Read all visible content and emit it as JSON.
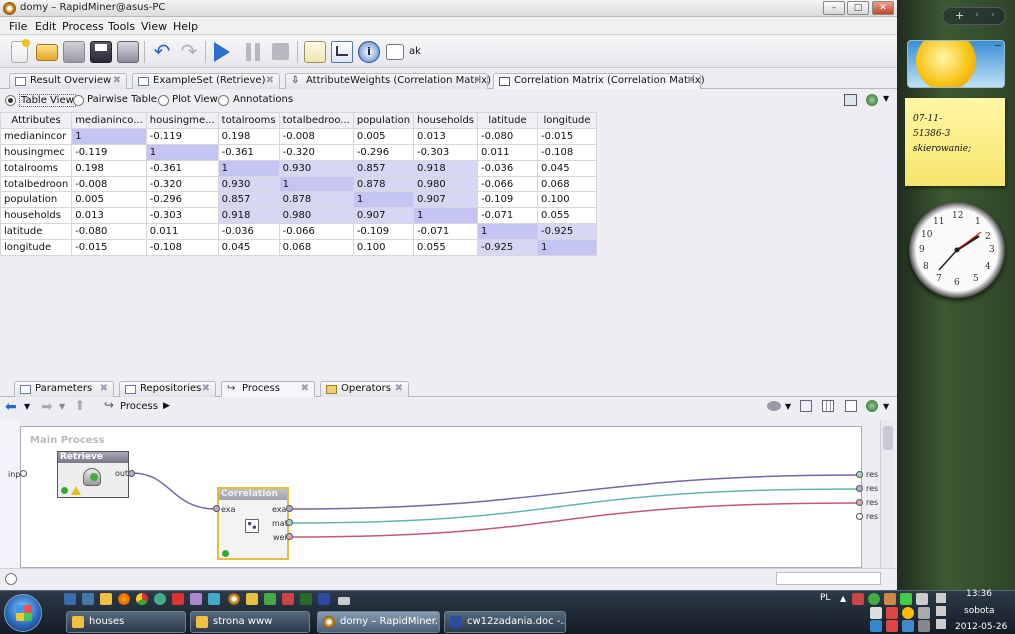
{
  "window": {
    "title": "domy – RapidMiner@asus-PC",
    "min": "–",
    "max": "□",
    "close": "✕"
  },
  "menu": [
    "File",
    "Edit",
    "Process",
    "Tools",
    "View",
    "Help"
  ],
  "toolbar": {
    "ak_label": "ak"
  },
  "result_tabs": [
    {
      "label": "Result Overview"
    },
    {
      "label": "ExampleSet (Retrieve)"
    },
    {
      "label": "AttributeWeights (Correlation Matrix)"
    },
    {
      "label": "Correlation Matrix (Correlation Matrix)"
    }
  ],
  "view_options": [
    "Table View",
    "Pairwise Table",
    "Plot View",
    "Annotations"
  ],
  "matrix": {
    "headers": [
      "Attributes",
      "medianinco...",
      "housingme...",
      "totalrooms",
      "totalbedroo...",
      "population",
      "households",
      "latitude",
      "longitude"
    ],
    "rows": [
      [
        "medianincor",
        "1",
        "-0.119",
        "0.198",
        "-0.008",
        "0.005",
        "0.013",
        "-0.080",
        "-0.015"
      ],
      [
        "housingmec",
        "-0.119",
        "1",
        "-0.361",
        "-0.320",
        "-0.296",
        "-0.303",
        "0.011",
        "-0.108"
      ],
      [
        "totalrooms",
        "0.198",
        "-0.361",
        "1",
        "0.930",
        "0.857",
        "0.918",
        "-0.036",
        "0.045"
      ],
      [
        "totalbedroon",
        "-0.008",
        "-0.320",
        "0.930",
        "1",
        "0.878",
        "0.980",
        "-0.066",
        "0.068"
      ],
      [
        "population",
        "0.005",
        "-0.296",
        "0.857",
        "0.878",
        "1",
        "0.907",
        "-0.109",
        "0.100"
      ],
      [
        "households",
        "0.013",
        "-0.303",
        "0.918",
        "0.980",
        "0.907",
        "1",
        "-0.071",
        "0.055"
      ],
      [
        "latitude",
        "-0.080",
        "0.011",
        "-0.036",
        "-0.066",
        "-0.109",
        "-0.071",
        "1",
        "-0.925"
      ],
      [
        "longitude",
        "-0.015",
        "-0.108",
        "0.045",
        "0.068",
        "0.100",
        "0.055",
        "-0.925",
        "1"
      ]
    ]
  },
  "lower_tabs": [
    {
      "label": "Parameters"
    },
    {
      "label": "Repositories"
    },
    {
      "label": "Process"
    },
    {
      "label": "Operators"
    }
  ],
  "process": {
    "breadcrumb": "Process",
    "main_label": "Main Process",
    "inp_label": "inp",
    "retrieve": {
      "title": "Retrieve",
      "out": "out"
    },
    "corr": {
      "title": "Correlation M...",
      "in": "exa",
      "out1": "exa",
      "out2": "mat",
      "out3": "wei"
    },
    "res_labels": [
      "res",
      "res",
      "res",
      "res"
    ],
    "wire_colors": {
      "example": "#7a63a8",
      "matrix": "#5fb7a9",
      "weights": "#c1587e"
    }
  },
  "desktop": {
    "note_lines": [
      "07-11-",
      "51386-3",
      "skierowanie;"
    ],
    "clock_numbers": [
      "12",
      "1",
      "2",
      "3",
      "4",
      "5",
      "6",
      "7",
      "8",
      "9",
      "10",
      "11"
    ]
  },
  "taskbar": {
    "tasks": [
      "houses",
      "strona www",
      "domy – RapidMiner...",
      "cw12zadania.doc -..."
    ],
    "lang": "PL",
    "time": "13:36",
    "day": "sobota",
    "date": "2012-05-26"
  }
}
